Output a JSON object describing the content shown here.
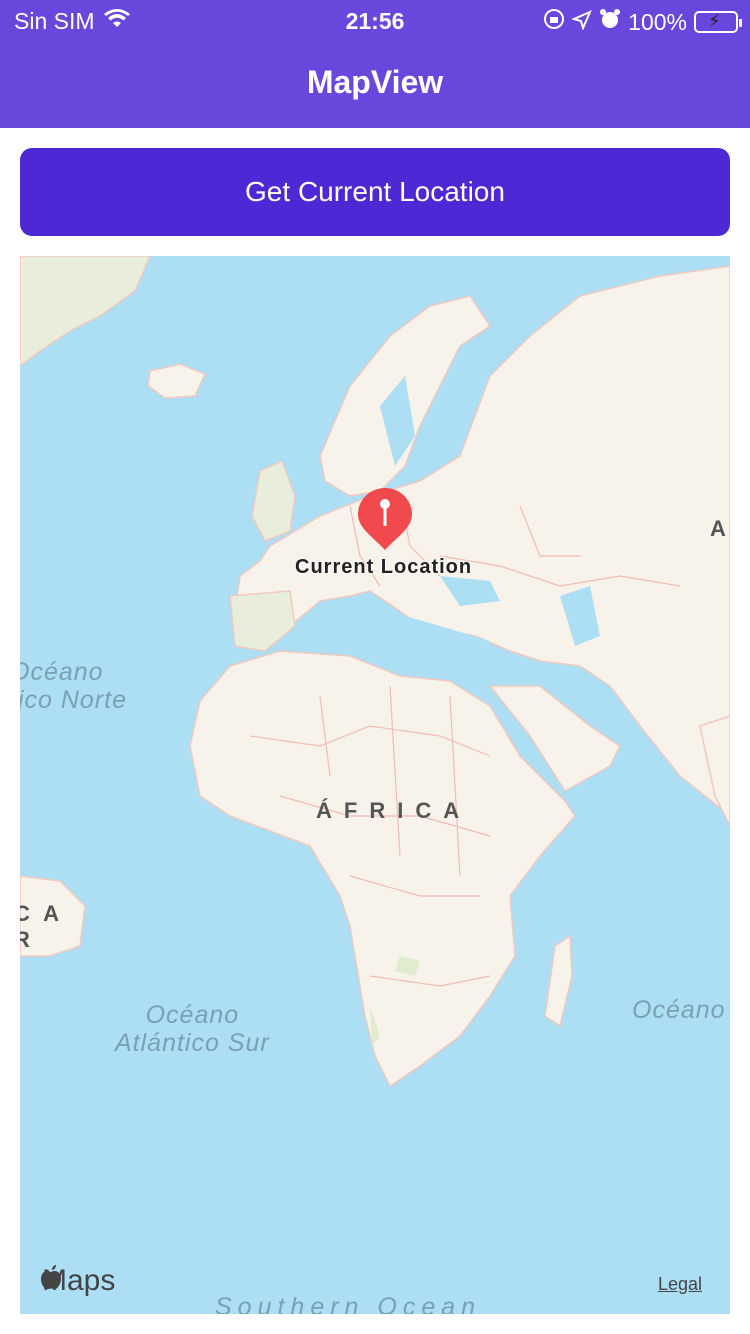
{
  "status_bar": {
    "carrier": "Sin SIM",
    "time": "21:56",
    "battery": "100%"
  },
  "header": {
    "title": "MapView"
  },
  "actions": {
    "get_location_label": "Get Current Location"
  },
  "map": {
    "pin_label": "Current Location",
    "regions": {
      "africa": "ÁFRICA",
      "atlantic_north": "Océano\ntico Norte",
      "atlantic_south": "Océano\nAtlántico Sur",
      "indian": "Océano",
      "southern": "Southern Ocean",
      "asia_edge": "A",
      "america_edge": "C A\nR"
    },
    "attribution": "Maps",
    "legal": "Legal"
  },
  "colors": {
    "header": "#6a47dc",
    "button": "#4f28d6",
    "water": "#acdff4",
    "land": "#f7f2ea",
    "pin": "#f0494e"
  }
}
